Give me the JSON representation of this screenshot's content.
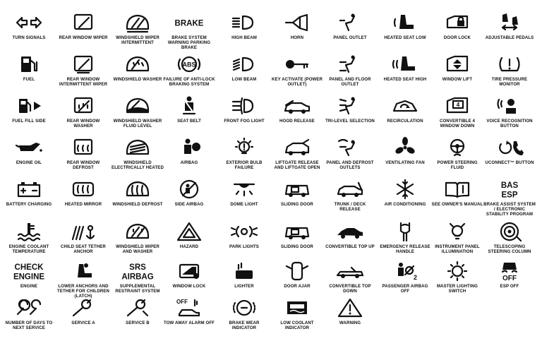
{
  "columns": [
    {
      "id": "c1",
      "cells": [
        {
          "name": "turn-signals",
          "label": "TURN SIGNALS",
          "icon": "turn-signals-icon"
        },
        {
          "name": "fuel",
          "label": "FUEL",
          "icon": "fuel-pump-icon"
        },
        {
          "name": "fuel-fill-side",
          "label": "FUEL FILL SIDE",
          "icon": "fuel-fill-side-icon"
        },
        {
          "name": "engine-oil",
          "label": "ENGINE OIL",
          "icon": "oil-can-icon"
        },
        {
          "name": "battery-charging",
          "label": "BATTERY CHARGING",
          "icon": "battery-icon"
        },
        {
          "name": "engine-coolant-temperature",
          "label": "ENGINE COOLANT TEMPERATURE",
          "icon": "coolant-temperature-icon"
        },
        {
          "name": "engine",
          "label": "ENGINE",
          "icon": "check-engine-text-icon",
          "text": [
            "CHECK",
            "ENGINE"
          ]
        },
        {
          "name": "number-of-days-to-next-service",
          "label": "NUMBER OF DAYS TO NEXT SERVICE",
          "icon": "service-days-icon"
        }
      ]
    },
    {
      "id": "c2",
      "cells": [
        {
          "name": "rear-window-wiper",
          "label": "REAR WINDOW WIPER",
          "icon": "rear-wiper-icon"
        },
        {
          "name": "rear-window-intermittent-wiper",
          "label": "REAR WINDOW INTERMITTENT WIPER",
          "icon": "rear-wiper-intermittent-icon"
        },
        {
          "name": "rear-window-washer",
          "label": "REAR WINDOW WASHER",
          "icon": "rear-washer-icon"
        },
        {
          "name": "rear-window-defrost",
          "label": "REAR WINDOW DEFROST",
          "icon": "rear-defrost-icon"
        },
        {
          "name": "heated-mirror",
          "label": "HEATED MIRROR",
          "icon": "heated-mirror-icon"
        },
        {
          "name": "child-seat-tether-anchor",
          "label": "CHILD SEAT TETHER ANCHOR",
          "icon": "child-seat-anchor-icon"
        },
        {
          "name": "lower-anchors-tether",
          "label": "LOWER ANCHORS AND TETHER FOR CHILDREN (LATCH)",
          "icon": "latch-icon"
        },
        {
          "name": "service-a",
          "label": "SERVICE A",
          "icon": "wrench-icon"
        }
      ]
    },
    {
      "id": "c3",
      "cells": [
        {
          "name": "windshield-wiper-intermittent",
          "label": "WINDSHIELD WIPER INTERMITTENT",
          "icon": "windshield-wiper-intermittent-icon"
        },
        {
          "name": "windshield-washer",
          "label": "WINDSHIELD WASHER",
          "icon": "windshield-washer-icon"
        },
        {
          "name": "windshield-washer-fluid-level",
          "label": "WINDSHIELD WASHER FLUID LEVEL",
          "icon": "washer-fluid-icon"
        },
        {
          "name": "windshield-electrically-heated",
          "label": "WINDSHIELD ELECTRICALLY HEATED",
          "icon": "heated-windshield-icon"
        },
        {
          "name": "windshield-defrost",
          "label": "WINDSHIELD DEFROST",
          "icon": "windshield-defrost-icon"
        },
        {
          "name": "windshield-wiper-and-washer",
          "label": "WINDSHIELD WIPER AND WASHER",
          "icon": "wiper-washer-icon"
        },
        {
          "name": "supplemental-restraint-system",
          "label": "SUPPLEMENTAL RESTRAINT SYSTEM",
          "icon": "srs-airbag-text-icon",
          "text": [
            "SRS",
            "AIRBAG"
          ]
        },
        {
          "name": "service-b",
          "label": "SERVICE B",
          "icon": "wrench-b-icon"
        }
      ]
    },
    {
      "id": "c4",
      "cells": [
        {
          "name": "brake-system-warning",
          "label": "BRAKE SYSTEM WARNING PARKING BRAKE",
          "icon": "brake-text-icon",
          "text": [
            "BRAKE"
          ]
        },
        {
          "name": "failure-of-anti-lock-braking",
          "label": "FAILURE OF ANTI-LOCK BRAKING SYSTEM",
          "icon": "abs-icon",
          "text": [
            "ABS"
          ]
        },
        {
          "name": "seat-belt",
          "label": "SEAT BELT",
          "icon": "seat-belt-icon"
        },
        {
          "name": "airbag",
          "label": "AIRBAG",
          "icon": "airbag-icon"
        },
        {
          "name": "side-airbag",
          "label": "SIDE AIRBAG",
          "icon": "side-airbag-icon"
        },
        {
          "name": "hazard",
          "label": "HAZARD",
          "icon": "hazard-icon"
        },
        {
          "name": "window-lock",
          "label": "WINDOW LOCK",
          "icon": "window-lock-icon"
        },
        {
          "name": "tow-away-alarm-off",
          "label": "TOW AWAY ALARM OFF",
          "icon": "tow-alarm-off-icon",
          "text": [
            "OFF"
          ]
        }
      ]
    },
    {
      "id": "c5",
      "cells": [
        {
          "name": "high-beam",
          "label": "HIGH BEAM",
          "icon": "high-beam-icon"
        },
        {
          "name": "low-beam",
          "label": "LOW BEAM",
          "icon": "low-beam-icon"
        },
        {
          "name": "front-fog-light",
          "label": "FRONT FOG LIGHT",
          "icon": "fog-light-icon"
        },
        {
          "name": "exterior-bulb-failure",
          "label": "EXTERIOR BULB FAILURE",
          "icon": "bulb-failure-icon"
        },
        {
          "name": "dome-light",
          "label": "DOME LIGHT",
          "icon": "dome-light-icon"
        },
        {
          "name": "park-lights",
          "label": "PARK LIGHTS",
          "icon": "park-lights-icon"
        },
        {
          "name": "lighter",
          "label": "LIGHTER",
          "icon": "lighter-icon"
        },
        {
          "name": "brake-wear-indicator",
          "label": "BRAKE WEAR INDICATOR",
          "icon": "brake-wear-icon"
        }
      ]
    },
    {
      "id": "c6",
      "cells": [
        {
          "name": "horn",
          "label": "HORN",
          "icon": "horn-icon"
        },
        {
          "name": "key-activate",
          "label": "KEY ACTIVATE (POWER OUTLET)",
          "icon": "key-icon"
        },
        {
          "name": "hood-release",
          "label": "HOOD RELEASE",
          "icon": "hood-release-icon"
        },
        {
          "name": "liftgate-release",
          "label": "LIFTGATE RELEASE AND LIFTGATE OPEN",
          "icon": "liftgate-icon"
        },
        {
          "name": "sliding-door-1",
          "label": "SLIDING DOOR",
          "icon": "sliding-door-icon"
        },
        {
          "name": "sliding-door-2",
          "label": "SLIDING DOOR",
          "icon": "sliding-door-icon"
        },
        {
          "name": "door-ajar",
          "label": "DOOR AJAR",
          "icon": "door-ajar-icon"
        },
        {
          "name": "low-coolant-indicator",
          "label": "LOW COOLANT INDICATOR",
          "icon": "low-coolant-icon"
        }
      ]
    },
    {
      "id": "c7",
      "cells": [
        {
          "name": "panel-outlet",
          "label": "PANEL OUTLET",
          "icon": "panel-outlet-icon"
        },
        {
          "name": "panel-and-floor-outlet",
          "label": "PANEL AND FLOOR OUTLET",
          "icon": "panel-floor-outlet-icon"
        },
        {
          "name": "tri-level-selection",
          "label": "TRI-LEVEL SELECTION",
          "icon": "tri-level-icon"
        },
        {
          "name": "panel-and-defrost-outlets",
          "label": "PANEL AND DEFROST OUTLETS",
          "icon": "panel-defrost-icon"
        },
        {
          "name": "trunk-deck-release",
          "label": "TRUNK / DECK RELEASE",
          "icon": "trunk-release-icon"
        },
        {
          "name": "convertible-top-up",
          "label": "CONVERTIBLE TOP UP",
          "icon": "convertible-up-icon"
        },
        {
          "name": "convertible-top-down",
          "label": "CONVERTIBLE TOP DOWN",
          "icon": "convertible-down-icon"
        },
        {
          "name": "warning",
          "label": "WARNING",
          "icon": "warning-triangle-icon"
        }
      ]
    },
    {
      "id": "c8",
      "cells": [
        {
          "name": "heated-seat-low",
          "label": "HEATED SEAT LOW",
          "icon": "heated-seat-low-icon"
        },
        {
          "name": "heated-seat-high",
          "label": "HEATED SEAT HIGH",
          "icon": "heated-seat-high-icon"
        },
        {
          "name": "recirculation",
          "label": "RECIRCULATION",
          "icon": "recirculation-icon"
        },
        {
          "name": "ventilating-fan",
          "label": "VENTILATING FAN",
          "icon": "fan-icon"
        },
        {
          "name": "air-conditioning",
          "label": "AIR CONDITIONING",
          "icon": "snowflake-icon"
        },
        {
          "name": "emergency-release-handle",
          "label": "EMERGENCY RELEASE HANDLE",
          "icon": "emergency-release-icon"
        },
        {
          "name": "passenger-airbag-off",
          "label": "PASSENGER AIRBAG OFF",
          "icon": "passenger-airbag-off-icon",
          "text": [
            "2"
          ]
        }
      ]
    },
    {
      "id": "c9",
      "cells": [
        {
          "name": "door-lock",
          "label": "DOOR LOCK",
          "icon": "door-lock-icon"
        },
        {
          "name": "window-lift",
          "label": "WINDOW LIFT",
          "icon": "window-lift-icon"
        },
        {
          "name": "convertible-4-window-down",
          "label": "CONVERTIBLE 4 WINDOW DOWN",
          "icon": "four-window-icon",
          "text": [
            "4"
          ]
        },
        {
          "name": "power-steering-fluid",
          "label": "POWER STEERING FLUID",
          "icon": "steering-fluid-icon"
        },
        {
          "name": "see-owners-manual",
          "label": "SEE OWNER'S MANUAL",
          "icon": "manual-icon"
        },
        {
          "name": "instrument-panel-illumination",
          "label": "INSTRUMENT PANEL ILLUMINATION",
          "icon": "panel-illumination-icon"
        },
        {
          "name": "master-lighting-switch",
          "label": "MASTER LIGHTING SWITCH",
          "icon": "master-lighting-icon"
        }
      ]
    },
    {
      "id": "c10",
      "cells": [
        {
          "name": "adjustable-pedals",
          "label": "ADJUSTABLE PEDALS",
          "icon": "pedals-icon"
        },
        {
          "name": "tire-pressure-monitor",
          "label": "TIRE PRESSURE MONITOR",
          "icon": "tire-pressure-icon"
        },
        {
          "name": "voice-recognition-button",
          "label": "VOICE RECOGNITION BUTTON",
          "icon": "voice-icon"
        },
        {
          "name": "uconnect-button",
          "label": "UCONNECT™ BUTTON",
          "icon": "uconnect-icon"
        },
        {
          "name": "brake-assist-system",
          "label": "BRAKE ASSIST SYSTEM / ELECTRONIC STABILITY PROGRAM",
          "icon": "bas-esp-text-icon",
          "text": [
            "BAS",
            "ESP"
          ]
        },
        {
          "name": "telescoping-steering-column",
          "label": "TELESCOPING STEERING COLUMN",
          "icon": "steering-wheel-icon"
        },
        {
          "name": "esp-off",
          "label": "ESP OFF",
          "icon": "esp-off-icon",
          "text": [
            "OFF"
          ]
        }
      ]
    }
  ]
}
